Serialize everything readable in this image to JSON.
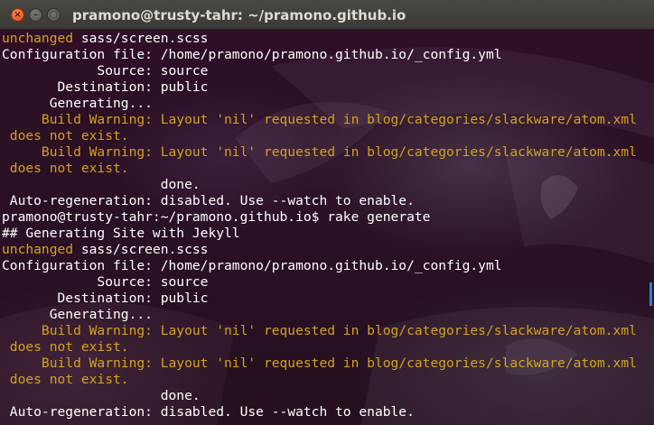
{
  "window": {
    "title": "pramono@trusty-tahr: ~/pramono.github.io",
    "close_icon": "×",
    "minimize_icon": "–",
    "maximize_icon": "▢"
  },
  "colors": {
    "normal_text": "#ffffff",
    "warning_text": "#d2a21f",
    "close_button": "#df4b16",
    "scrollbar": "#2f7fd0"
  },
  "terminal": {
    "lines": [
      {
        "segments": [
          {
            "text": "unchanged",
            "style": "yellow"
          },
          {
            "text": " sass/screen.scss",
            "style": "normal"
          }
        ]
      },
      {
        "segments": [
          {
            "text": "Configuration file: /home/pramono/pramono.github.io/_config.yml",
            "style": "normal"
          }
        ]
      },
      {
        "segments": [
          {
            "text": "            Source: source",
            "style": "normal"
          }
        ]
      },
      {
        "segments": [
          {
            "text": "       Destination: public",
            "style": "normal"
          }
        ]
      },
      {
        "segments": [
          {
            "text": "      Generating...",
            "style": "normal"
          }
        ]
      },
      {
        "segments": [
          {
            "text": "     Build Warning: Layout 'nil' requested in blog/categories/slackware/atom.xml",
            "style": "yellow"
          }
        ]
      },
      {
        "segments": [
          {
            "text": " does not exist.",
            "style": "yellow"
          }
        ]
      },
      {
        "segments": [
          {
            "text": "     Build Warning: Layout 'nil' requested in blog/categories/slackware/atom.xml",
            "style": "yellow"
          }
        ]
      },
      {
        "segments": [
          {
            "text": " does not exist.",
            "style": "yellow"
          }
        ]
      },
      {
        "segments": [
          {
            "text": "                    done.",
            "style": "normal"
          }
        ]
      },
      {
        "segments": [
          {
            "text": " Auto-regeneration: disabled. Use --watch to enable.",
            "style": "normal"
          }
        ]
      },
      {
        "segments": [
          {
            "text": "pramono@trusty-tahr:~/pramono.github.io$ rake generate",
            "style": "normal"
          }
        ]
      },
      {
        "segments": [
          {
            "text": "## Generating Site with Jekyll",
            "style": "normal"
          }
        ]
      },
      {
        "segments": [
          {
            "text": "unchanged",
            "style": "yellow"
          },
          {
            "text": " sass/screen.scss",
            "style": "normal"
          }
        ]
      },
      {
        "segments": [
          {
            "text": "Configuration file: /home/pramono/pramono.github.io/_config.yml",
            "style": "normal"
          }
        ]
      },
      {
        "segments": [
          {
            "text": "            Source: source",
            "style": "normal"
          }
        ]
      },
      {
        "segments": [
          {
            "text": "       Destination: public",
            "style": "normal"
          }
        ]
      },
      {
        "segments": [
          {
            "text": "      Generating...",
            "style": "normal"
          }
        ]
      },
      {
        "segments": [
          {
            "text": "     Build Warning: Layout 'nil' requested in blog/categories/slackware/atom.xml",
            "style": "yellow"
          }
        ]
      },
      {
        "segments": [
          {
            "text": " does not exist.",
            "style": "yellow"
          }
        ]
      },
      {
        "segments": [
          {
            "text": "     Build Warning: Layout 'nil' requested in blog/categories/slackware/atom.xml",
            "style": "yellow"
          }
        ]
      },
      {
        "segments": [
          {
            "text": " does not exist.",
            "style": "yellow"
          }
        ]
      },
      {
        "segments": [
          {
            "text": "                    done.",
            "style": "normal"
          }
        ]
      },
      {
        "segments": [
          {
            "text": " Auto-regeneration: disabled. Use --watch to enable.",
            "style": "normal"
          }
        ]
      }
    ]
  }
}
